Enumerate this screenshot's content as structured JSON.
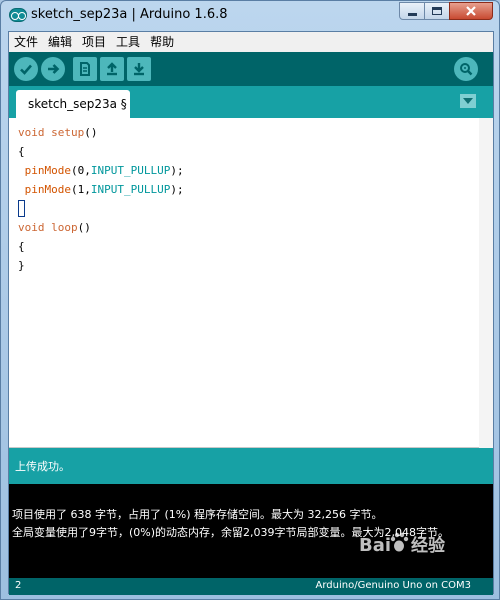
{
  "window": {
    "title": "sketch_sep23a | Arduino 1.6.8"
  },
  "menu": {
    "items": [
      "文件",
      "编辑",
      "项目",
      "工具",
      "帮助"
    ]
  },
  "toolbar": {
    "buttons": [
      "verify-icon",
      "upload-icon",
      "new-icon",
      "open-icon",
      "save-icon"
    ],
    "right_button": "serial-monitor-icon",
    "accent": "#006468"
  },
  "tabs": [
    {
      "label": "sketch_sep23a §"
    }
  ],
  "editor": {
    "lines": [
      [
        {
          "t": "void ",
          "c": "kw"
        },
        {
          "t": "setup",
          "c": "kw"
        },
        {
          "t": "()",
          "c": ""
        }
      ],
      [
        {
          "t": "{",
          "c": ""
        }
      ],
      [
        {
          "t": " ",
          "c": ""
        },
        {
          "t": "pinMode",
          "c": "fn"
        },
        {
          "t": "(0,",
          "c": ""
        },
        {
          "t": "INPUT_PULLUP",
          "c": "const"
        },
        {
          "t": ");",
          "c": ""
        }
      ],
      [
        {
          "t": " ",
          "c": ""
        },
        {
          "t": "pinMode",
          "c": "fn"
        },
        {
          "t": "(1,",
          "c": ""
        },
        {
          "t": "INPUT_PULLUP",
          "c": "const"
        },
        {
          "t": ");",
          "c": ""
        }
      ],
      [
        {
          "t": "",
          "c": "caret"
        }
      ],
      [
        {
          "t": "void ",
          "c": "kw"
        },
        {
          "t": "loop",
          "c": "kw"
        },
        {
          "t": "()",
          "c": ""
        }
      ],
      [
        {
          "t": "{",
          "c": ""
        }
      ],
      [
        {
          "t": "}",
          "c": ""
        }
      ]
    ]
  },
  "status": {
    "message": "上传成功。"
  },
  "console": {
    "lines": [
      "项目使用了 638 字节，占用了 (1%) 程序存储空间。最大为 32,256 字节。",
      "全局变量使用了9字节，(0%)的动态内存，余留2,039字节局部变量。最大为2,048字节。"
    ]
  },
  "bottom": {
    "line_number": "2",
    "board": "Arduino/Genuino Uno on COM3"
  },
  "watermark": {
    "text": "Bai经验"
  }
}
